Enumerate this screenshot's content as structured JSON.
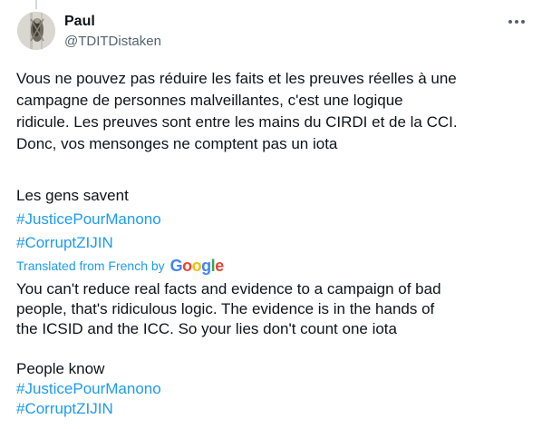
{
  "author": {
    "name": "Paul",
    "handle": "@TDITDistaken"
  },
  "tweet": {
    "original_lines": [
      "Vous ne pouvez pas réduire les faits et les preuves réelles à une",
      "campagne de personnes malveillantes, c'est une logique",
      "ridicule. Les preuves sont entre les mains du CIRDI et de la CCI.",
      "Donc, vos mensonges ne comptent pas un iota"
    ],
    "original_tail": "Les gens savent",
    "hashtags": [
      "#JusticePourManono",
      "#CorruptZIJIN"
    ]
  },
  "translation": {
    "label": "Translated from French by",
    "provider": "Google",
    "provider_letters": [
      "G",
      "o",
      "o",
      "g",
      "l",
      "e"
    ],
    "provider_colors": [
      "#4285F4",
      "#EA4335",
      "#FBBC05",
      "#4285F4",
      "#34A853",
      "#EA4335"
    ],
    "lines": [
      "You can't reduce real facts and evidence to a campaign of bad",
      "people, that's ridiculous logic. The evidence is in the hands of",
      "the ICSID and the ICC. So your lies don't count one iota"
    ],
    "tail": "People know",
    "hashtags": [
      "#JusticePourManono",
      "#CorruptZIJIN"
    ]
  },
  "icons": {
    "more": "more-horizontal-icon",
    "avatar": "avatar-photo"
  },
  "colors": {
    "text": "#0f1419",
    "secondary": "#536471",
    "link": "#1d9bf0"
  }
}
